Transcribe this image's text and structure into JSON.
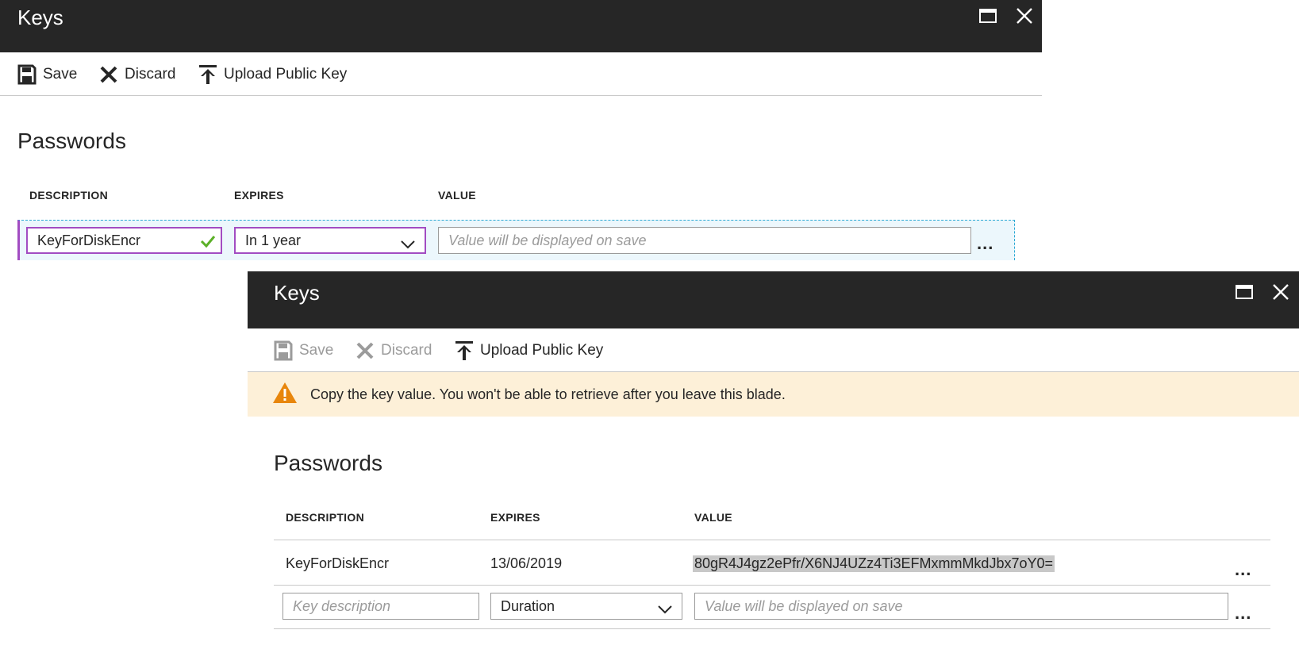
{
  "back_blade": {
    "title": "Keys",
    "toolbar": {
      "save_label": "Save",
      "discard_label": "Discard",
      "upload_label": "Upload Public Key"
    },
    "section_title": "Passwords",
    "columns": [
      "DESCRIPTION",
      "EXPIRES",
      "VALUE"
    ],
    "edit_row": {
      "description": "KeyForDiskEncr",
      "expires": "In 1 year",
      "value_placeholder": "Value will be displayed on save",
      "more": "..."
    }
  },
  "front_blade": {
    "title": "Keys",
    "toolbar": {
      "save_label": "Save",
      "discard_label": "Discard",
      "upload_label": "Upload Public Key"
    },
    "warning": "Copy the key value. You won't be able to retrieve after you leave this blade.",
    "section_title": "Passwords",
    "columns": [
      "DESCRIPTION",
      "EXPIRES",
      "VALUE"
    ],
    "rows": [
      {
        "description": "KeyForDiskEncr",
        "expires": "13/06/2019",
        "value": "80gR4J4gz2ePfr/X6NJ4UZz4Ti3EFMxmmMkdJbx7oY0=",
        "more": "..."
      }
    ],
    "new_row": {
      "description_placeholder": "Key description",
      "duration": "Duration",
      "value_placeholder": "Value will be displayed on save",
      "more": "..."
    }
  },
  "colors": {
    "titlebar_bg": "#262626",
    "focus_border": "#a24cc2",
    "valid_check": "#5bb028",
    "warning_bg": "#fdf0d8",
    "warning_icon": "#e8860c",
    "dashed_focus": "#2aa8d4"
  }
}
